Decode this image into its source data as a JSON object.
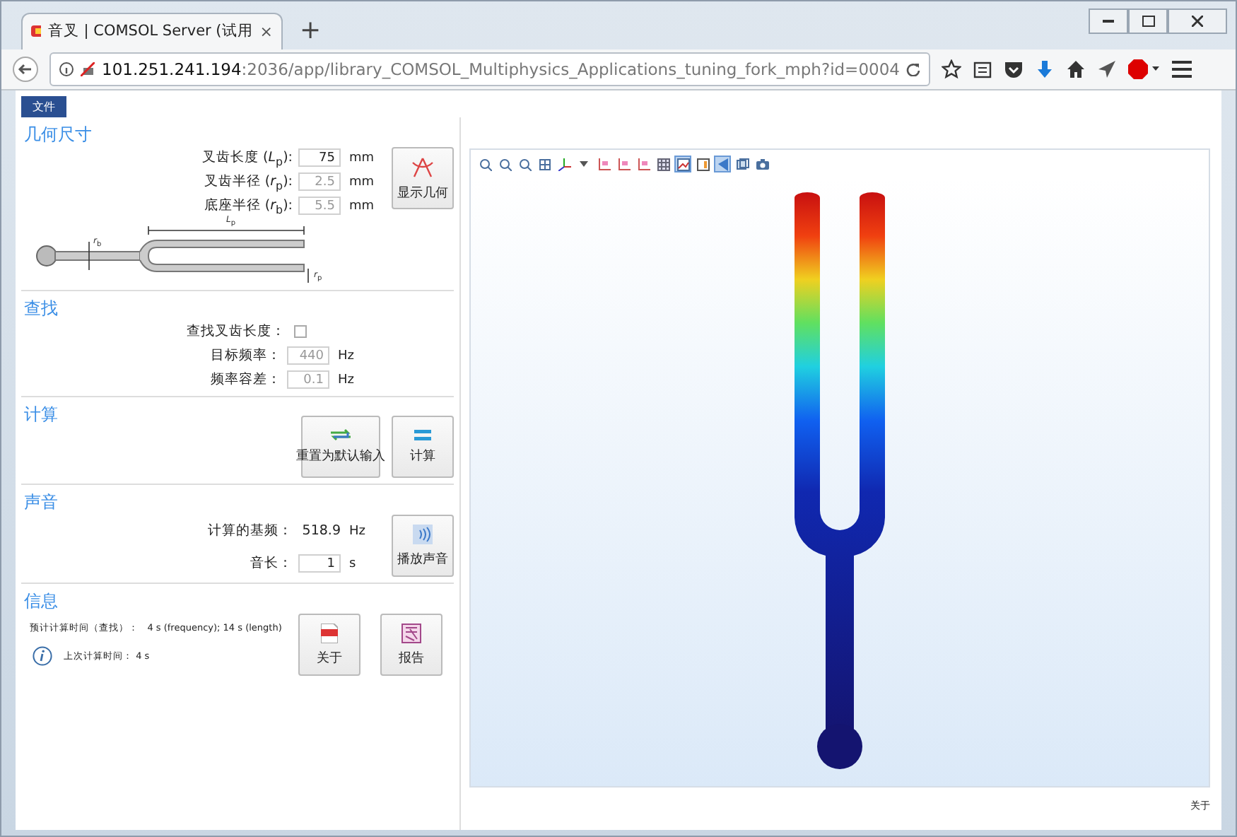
{
  "browser": {
    "tab_title": "音叉 | COMSOL Server (试用",
    "new_tab": "+",
    "tab_close": "×",
    "url_host": "101.251.241.194",
    "url_path": ":2036/app/library_COMSOL_Multiphysics_Applications_tuning_fork_mph?id=0004"
  },
  "menu": {
    "file": "文件"
  },
  "geometry": {
    "title": "几何尺寸",
    "fields": [
      {
        "label": "叉齿长度 (*L*$_{p}$):",
        "value": "75",
        "unit": "mm",
        "disabled": false
      },
      {
        "label": "叉齿半径 (*r*$_{p}$):",
        "value": "2.5",
        "unit": "mm",
        "disabled": true
      },
      {
        "label": "底座半径 (*r*$_{b}$):",
        "value": "5.5",
        "unit": "mm",
        "disabled": true
      }
    ],
    "button": "显示几何",
    "diagram_labels": [
      "*L*$_{p}$",
      "*r*$_{b}$",
      "*r*$_{p}$"
    ]
  },
  "find": {
    "title": "查找",
    "check": {
      "label": "查找叉齿长度：",
      "checked": false
    },
    "fields": [
      {
        "label": "目标频率：",
        "value": "440",
        "unit": "Hz",
        "disabled": true
      },
      {
        "label": "频率容差：",
        "value": "0.1",
        "unit": "Hz",
        "disabled": true
      }
    ]
  },
  "compute": {
    "title": "计算",
    "buttons": [
      {
        "kind": "reset",
        "label": "重置为默认输入"
      },
      {
        "kind": "equals",
        "label": "计算"
      }
    ]
  },
  "sound": {
    "title": "声音",
    "rows": [
      {
        "kind": "readout",
        "label": "计算的基频：",
        "value": "518.9",
        "unit": "Hz"
      },
      {
        "kind": "field",
        "label": "音长：",
        "value": "1",
        "unit": "s"
      }
    ],
    "button": "播放声音"
  },
  "info": {
    "title": "信息",
    "estimate": "预计计算时间（查找）：   4 s (frequency); 14 s (length)",
    "last": "上次计算时间： 4 s",
    "buttons": [
      {
        "kind": "pdf",
        "label": "关于"
      },
      {
        "kind": "report",
        "label": "报告"
      }
    ]
  },
  "graphics_toolbar": [
    {
      "kind": "zoom-in",
      "selected": false
    },
    {
      "kind": "zoom-out",
      "selected": false
    },
    {
      "kind": "zoom-box",
      "selected": false
    },
    {
      "kind": "zoom-extents",
      "selected": false
    },
    {
      "kind": "axes",
      "selected": false
    },
    {
      "kind": "caret",
      "selected": false
    },
    {
      "kind": "view",
      "selected": false
    },
    {
      "kind": "view",
      "selected": false
    },
    {
      "kind": "view",
      "selected": false
    },
    {
      "kind": "grid",
      "selected": false
    },
    {
      "kind": "scene",
      "selected": true
    },
    {
      "kind": "legend",
      "selected": false
    },
    {
      "kind": "light",
      "selected": true
    },
    {
      "kind": "transparency",
      "selected": false
    },
    {
      "kind": "camera",
      "selected": false
    }
  ],
  "footer": {
    "link": "关于"
  }
}
